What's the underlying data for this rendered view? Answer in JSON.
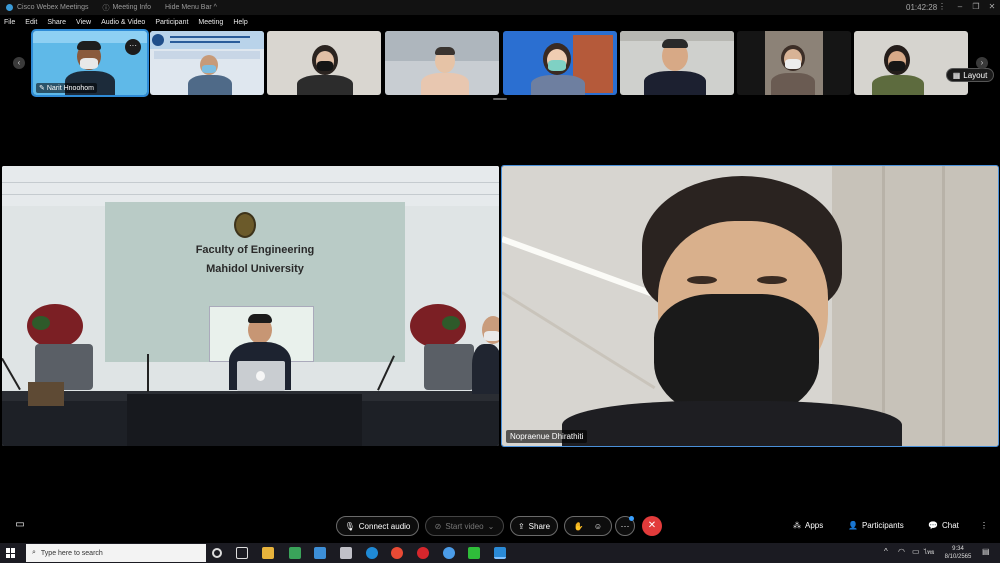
{
  "titlebar": {
    "app_name": "Cisco Webex Meetings",
    "meeting_info": "Meeting Info",
    "hide_menu_bar": "Hide Menu Bar ^",
    "timer": "01:42:28"
  },
  "menu": [
    "File",
    "Edit",
    "Share",
    "View",
    "Audio & Video",
    "Participant",
    "Meeting",
    "Help"
  ],
  "thumbnails": {
    "first_participant_name": "Narit Hnoohom",
    "layout_label": "Layout"
  },
  "main_videos": {
    "left_sign_line1": "Faculty of Engineering",
    "left_sign_line2": "Mahidol University",
    "right_name": "Nopraenue Dhirathiti"
  },
  "controls": {
    "connect_audio": "Connect audio",
    "start_video": "Start video",
    "share": "Share",
    "apps": "Apps",
    "participants": "Participants",
    "chat": "Chat"
  },
  "taskbar": {
    "search_placeholder": "Type here to search",
    "lang": "ไทย",
    "time": "9:34",
    "date": "8/10/2565"
  },
  "colors": {
    "accent_blue": "#2f8bd6",
    "end_red": "#e23b3b"
  }
}
